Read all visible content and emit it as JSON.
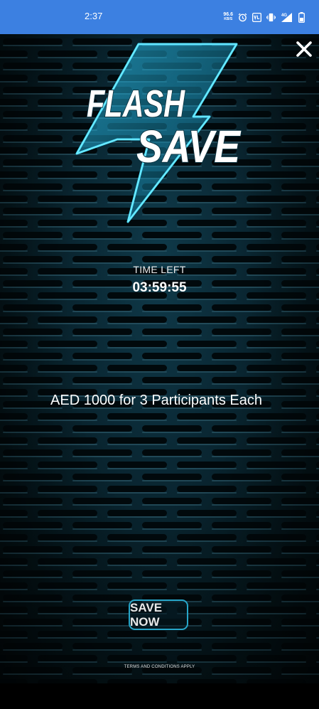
{
  "status_bar": {
    "time": "2:37",
    "speed_value": "96.6",
    "speed_unit": "KB/S",
    "network_type": "4G",
    "icons": [
      "data-speed-indicator",
      "alarm-icon",
      "volte-icon",
      "vibrate-icon",
      "signal-icon",
      "battery-icon"
    ],
    "background_color": "#3c80e1"
  },
  "popup": {
    "close_icon": "close-icon",
    "logo": {
      "line1": "FLASH",
      "line2": "SAVE",
      "icon": "lightning-bolt-icon",
      "accent_color": "#2fd0ff"
    },
    "time_left_label": "TIME LEFT",
    "countdown": "03:59:55",
    "offer_text": "AED 1000 for 3 Participants Each",
    "cta_label": "SAVE NOW",
    "cta_border_color": "#27a6c9",
    "terms_text": "TERMS AND CONDITIONS APPLY"
  }
}
